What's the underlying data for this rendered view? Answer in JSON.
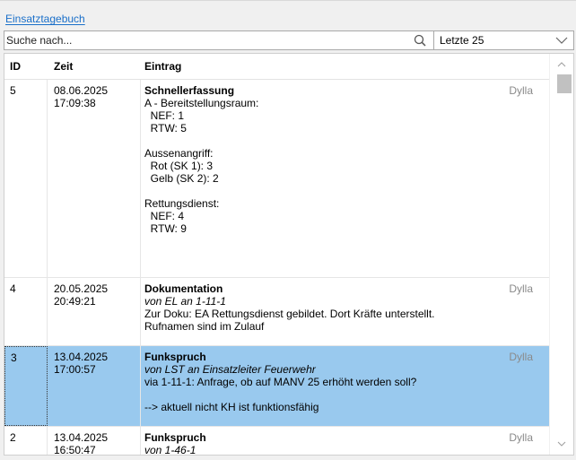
{
  "panel": {
    "title": "Einsatztagebuch"
  },
  "search": {
    "placeholder": "Suche nach...",
    "icon": "search-icon"
  },
  "filter": {
    "value": "Letzte 25"
  },
  "table": {
    "columns": {
      "id": "ID",
      "time": "Zeit",
      "entry": "Eintrag"
    },
    "rows": [
      {
        "id": "5",
        "date": "08.06.2025",
        "time": "17:09:38",
        "title": "Schnellerfassung",
        "from": "",
        "user": "Dylla",
        "lines": [
          "A - Bereitstellungsraum:",
          "  NEF: 1",
          "  RTW: 5",
          "",
          "Aussenangriff:",
          "  Rot (SK 1): 3",
          "  Gelb (SK 2): 2",
          "",
          "Rettungsdienst:",
          "  NEF: 4",
          "  RTW: 9"
        ]
      },
      {
        "id": "4",
        "date": "20.05.2025",
        "time": "20:49:21",
        "title": "Dokumentation",
        "from": "von EL an 1-11-1",
        "user": "Dylla",
        "lines": [
          "Zur Doku: EA Rettungsdienst gebildet. Dort Kräfte unterstellt.",
          "Rufnamen sind im Zulauf"
        ]
      },
      {
        "id": "3",
        "date": "13.04.2025",
        "time": "17:00:57",
        "title": "Funkspruch",
        "from": "von LST an Einsatzleiter Feuerwehr",
        "user": "Dylla",
        "lines": [
          "via 1-11-1: Anfrage, ob auf MANV 25 erhöht werden soll?",
          "",
          "--> aktuell nicht KH ist funktionsfähig"
        ]
      },
      {
        "id": "2",
        "date": "13.04.2025",
        "time": "16:50:47",
        "title": "Funkspruch",
        "from": "von 1-46-1",
        "user": "Dylla",
        "lines": []
      }
    ]
  },
  "colors": {
    "accent": "#1a6fc9",
    "selection": "#99c9ee",
    "muted": "#8a8a8a"
  }
}
